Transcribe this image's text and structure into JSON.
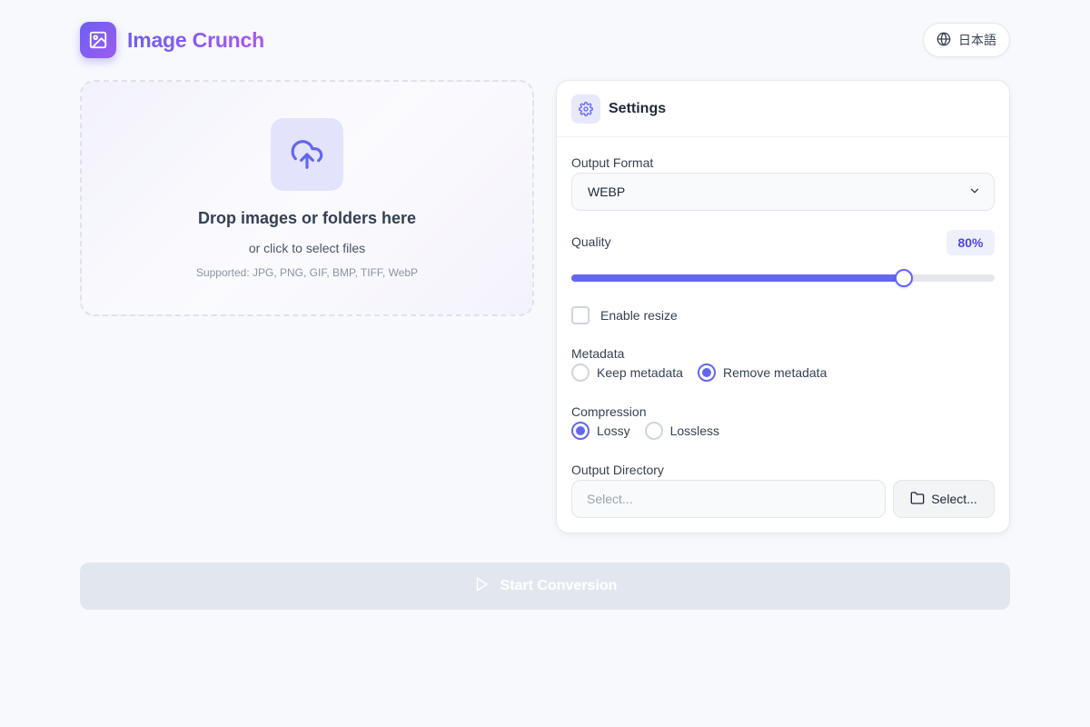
{
  "app": {
    "title": "Image Crunch",
    "logo_icon": "image-icon"
  },
  "header": {
    "language_label": "日本語",
    "language_icon": "globe-icon"
  },
  "dropzone": {
    "icon": "cloud-upload-icon",
    "title": "Drop images or folders here",
    "subtitle": "or click to select files",
    "supported": "Supported: JPG, PNG, GIF, BMP, TIFF, WebP"
  },
  "settings": {
    "title": "Settings",
    "icon": "gear-icon",
    "output_format": {
      "label": "Output Format",
      "value": "WEBP"
    },
    "quality": {
      "label": "Quality",
      "value_label": "80%",
      "value": 80
    },
    "resize": {
      "label": "Enable resize",
      "checked": false
    },
    "metadata": {
      "label": "Metadata",
      "options": [
        {
          "label": "Keep metadata",
          "selected": false
        },
        {
          "label": "Remove metadata",
          "selected": true
        }
      ]
    },
    "compression": {
      "label": "Compression",
      "options": [
        {
          "label": "Lossy",
          "selected": true
        },
        {
          "label": "Lossless",
          "selected": false
        }
      ]
    },
    "output_directory": {
      "label": "Output Directory",
      "placeholder": "Select...",
      "value": "",
      "button_label": "Select...",
      "button_icon": "folder-icon"
    }
  },
  "actions": {
    "start_label": "Start Conversion",
    "start_icon": "play-icon",
    "start_enabled": false
  },
  "colors": {
    "accent": "#6366f1",
    "brand_start": "#6d5ff2",
    "brand_end": "#a855f7",
    "disabled": "#e2e7ef"
  }
}
